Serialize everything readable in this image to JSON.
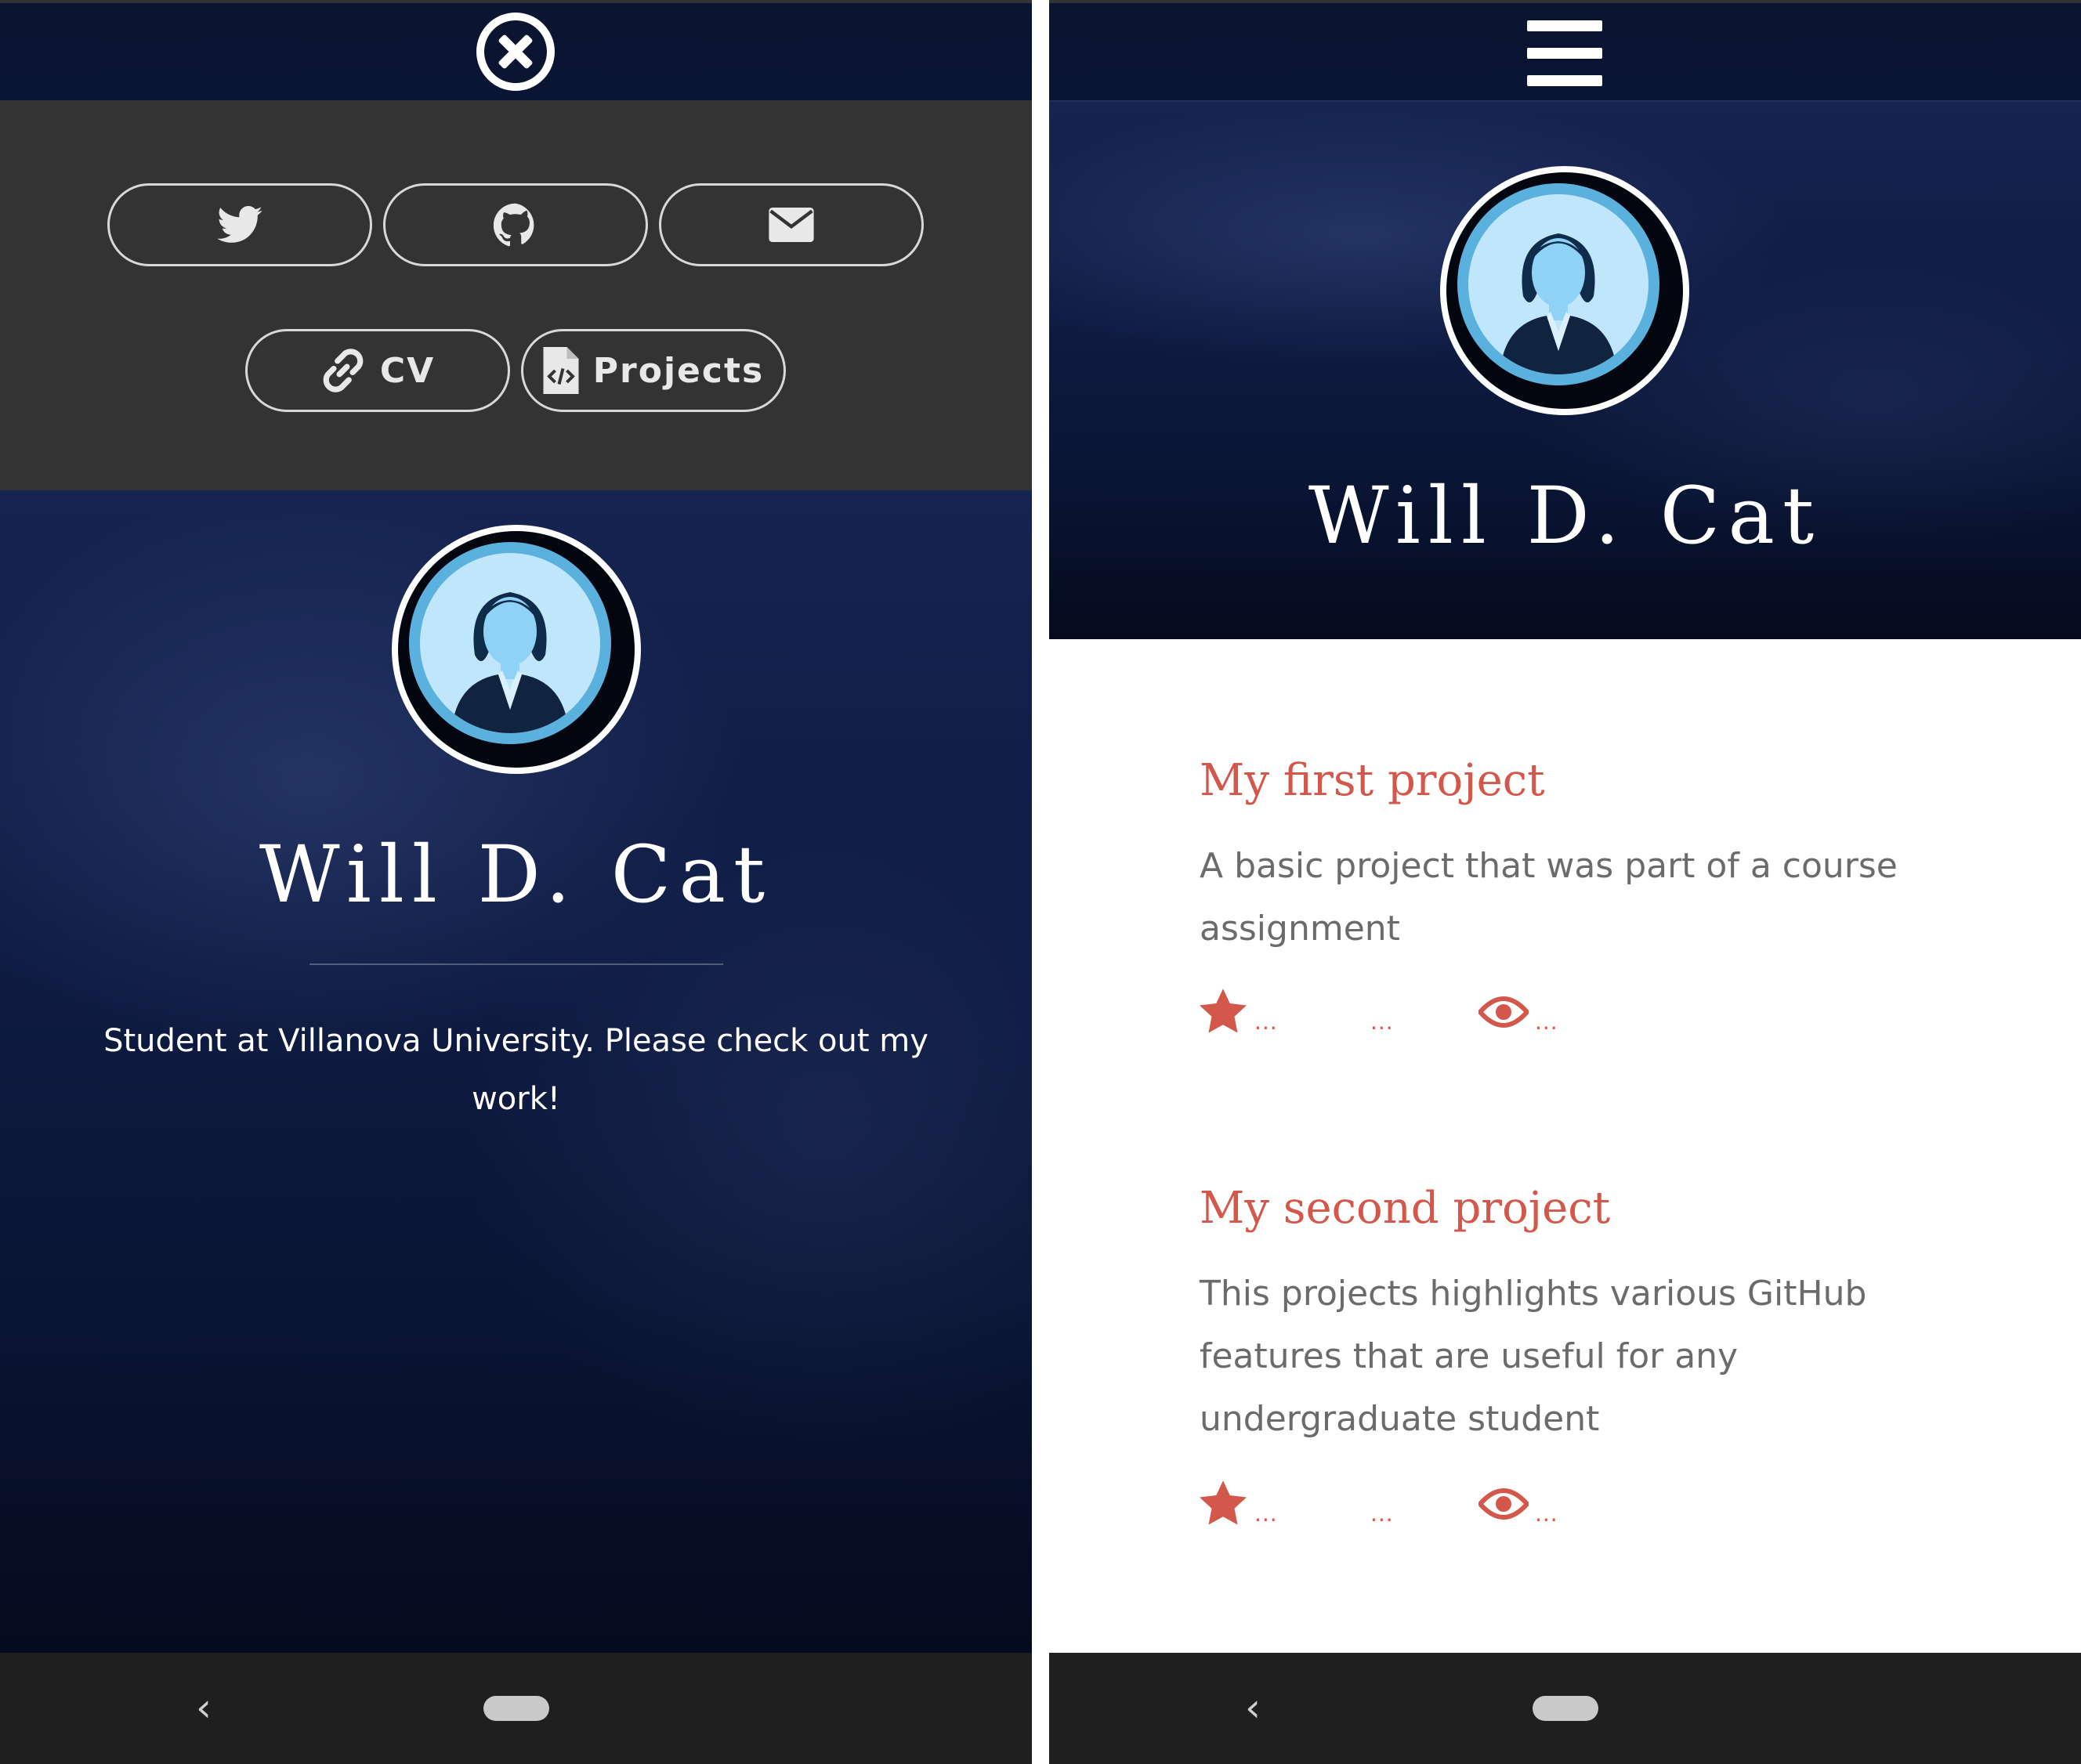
{
  "left_screen": {
    "menu": {
      "twitter_label": "",
      "github_label": "",
      "email_label": "",
      "cv_label": "CV",
      "projects_label": "Projects"
    },
    "profile": {
      "name": "Will D. Cat",
      "bio": "Student at Villanova University. Please check out my work!"
    }
  },
  "right_screen": {
    "profile": {
      "name": "Will D. Cat"
    },
    "projects": [
      {
        "title": "My first project",
        "description": "A basic project that was part of a course assignment",
        "stars": "...",
        "forks": "...",
        "watchers": "..."
      },
      {
        "title": "My second project",
        "description": "This projects highlights various GitHub features that are useful for any undergraduate student",
        "stars": "...",
        "forks": "...",
        "watchers": "..."
      }
    ]
  },
  "icons": {
    "close": "close-circle-icon",
    "menu": "hamburger-menu-icon",
    "twitter": "twitter-icon",
    "github": "github-icon",
    "email": "envelope-icon",
    "cv": "link-icon",
    "projects": "code-file-icon",
    "star": "star-icon",
    "eye": "eye-icon",
    "back": "nav-back-icon",
    "home": "nav-home-pill"
  },
  "colors": {
    "accent": "#d3574a",
    "menu_panel": "#333333",
    "hero_dark_blue": "#0f1c44",
    "nav_bar": "#1f1f1f"
  }
}
